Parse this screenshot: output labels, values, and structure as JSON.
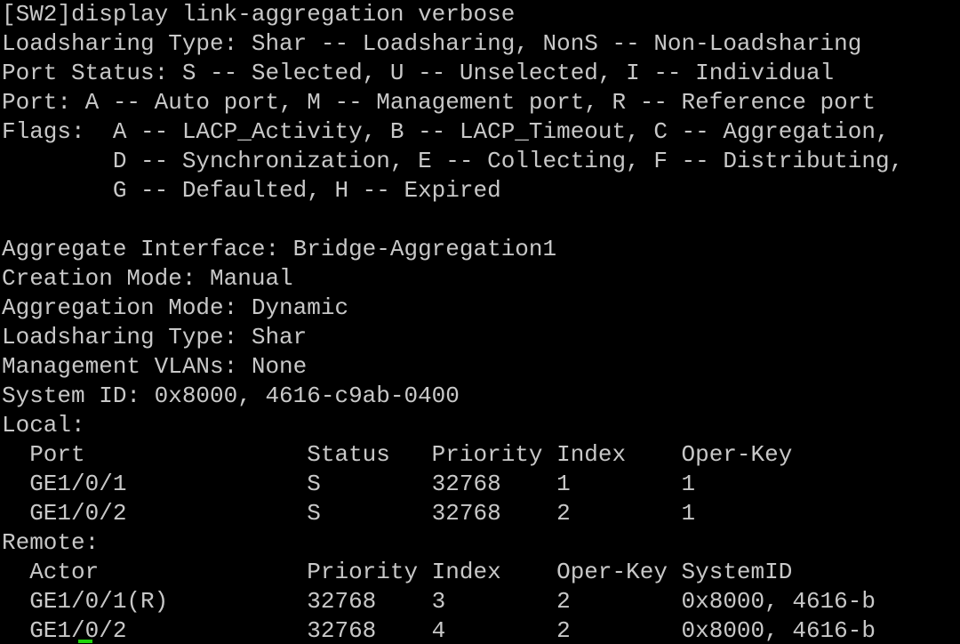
{
  "terminal": {
    "lines": [
      "[SW2]display link-aggregation verbose",
      "Loadsharing Type: Shar -- Loadsharing, NonS -- Non-Loadsharing",
      "Port Status: S -- Selected, U -- Unselected, I -- Individual",
      "Port: A -- Auto port, M -- Management port, R -- Reference port",
      "Flags:  A -- LACP_Activity, B -- LACP_Timeout, C -- Aggregation,",
      "        D -- Synchronization, E -- Collecting, F -- Distributing,",
      "        G -- Defaulted, H -- Expired",
      "",
      "Aggregate Interface: Bridge-Aggregation1",
      "Creation Mode: Manual",
      "Aggregation Mode: Dynamic",
      "Loadsharing Type: Shar",
      "Management VLANs: None",
      "System ID: 0x8000, 4616-c9ab-0400",
      "Local:",
      "  Port                Status   Priority Index    Oper-Key",
      "  GE1/0/1             S        32768    1        1",
      "  GE1/0/2             S        32768    2        1",
      "Remote:",
      "  Actor               Priority Index    Oper-Key SystemID",
      "  GE1/0/1(R)          32768    3        2        0x8000, 4616-b",
      "  GE1/0/2             32768    4        2        0x8000, 4616-b"
    ]
  },
  "colors": {
    "background": "#000000",
    "text": "#c8c8c8",
    "cursor": "#1fd40a"
  }
}
